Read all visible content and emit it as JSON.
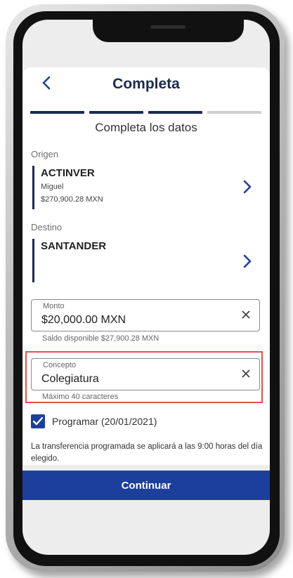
{
  "header": {
    "title": "Completa",
    "back_icon": "chevron-left-icon"
  },
  "steps": [
    {
      "state": "complete",
      "color": "#1b2a52"
    },
    {
      "state": "complete",
      "color": "#1b2a52"
    },
    {
      "state": "complete",
      "color": "#1b2a52"
    },
    {
      "state": "pending",
      "color": "#cfcfcf"
    }
  ],
  "subtitle": "Completa los datos",
  "origin": {
    "label": "Origen",
    "bank": "ACTINVER",
    "holder": "Miguel",
    "balance": "$270,900.28 MXN"
  },
  "destination": {
    "label": "Destino",
    "bank": "SANTANDER"
  },
  "amount": {
    "label": "Monto",
    "value": "$20,000.00 MXN",
    "helper": "Saldo disponible $27,900.28 MXN"
  },
  "concept": {
    "label": "Concepto",
    "value": "Colegiatura",
    "helper": "Máximo 40 caracteres"
  },
  "schedule": {
    "checked": true,
    "label": "Programar (20/01/2021)",
    "note": "La transferencia programada se aplicará a las 9:00 horas del día elegido."
  },
  "continue_label": "Continuar",
  "colors": {
    "accent": "#1d3f9c",
    "title": "#1b2a52",
    "highlight": "#e0534b"
  }
}
